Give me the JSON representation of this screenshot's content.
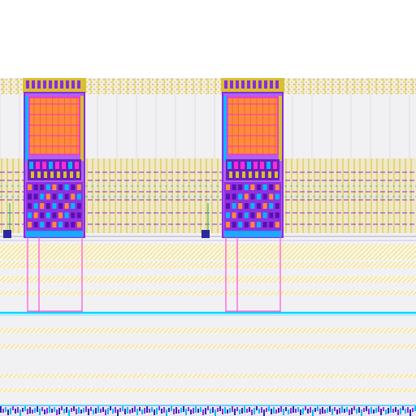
{
  "view": {
    "background": "#ffffff",
    "canvas_fill": "#f1f1f4"
  },
  "layers": {
    "metal_yellow": "#d8c030",
    "metal_yellow_dim": "#e6d27a",
    "poly_purple": "#8a2be2",
    "via_magenta": "#ff2bd6",
    "diff_cyan": "#00b8ff",
    "fill_orange": "#ff8a3d",
    "wire_magenta": "#ff4fd8",
    "wire_cyan": "#00d6ff",
    "dark_blue": "#2a2aa0",
    "grid_grey": "#cfcfd6",
    "pin_green": "#35c050"
  },
  "structure": {
    "macro_count": 2,
    "routing_bands": 2,
    "horizontal_metal_stripes": 8
  }
}
